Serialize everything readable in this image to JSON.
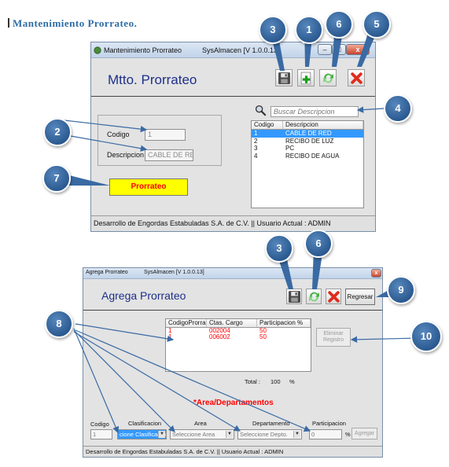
{
  "doc_heading": "Mantenimiento  Prorrateo.",
  "window1": {
    "title": "Mantenimiento Prorrateo",
    "app_version": "SysAlmacen [V 1.0.0.13]",
    "heading": "Mtto. Prorrateo",
    "codigo_label": "Codigo",
    "codigo_value": "1",
    "descripcion_label": "Descripcion",
    "descripcion_value": "CABLE DE RED",
    "prorrateo_button": "Prorrateo",
    "search_placeholder": "Buscar Descripcion",
    "list_headers": [
      "Codigo",
      "Descripcion"
    ],
    "list_rows": [
      {
        "codigo": "1",
        "descripcion": "CABLE DE RED",
        "selected": true
      },
      {
        "codigo": "2",
        "descripcion": "RECIBO DE LUZ",
        "selected": false
      },
      {
        "codigo": "3",
        "descripcion": "PC",
        "selected": false
      },
      {
        "codigo": "4",
        "descripcion": "RECIBO DE AGUA",
        "selected": false
      }
    ],
    "status": "Desarrollo de Engordas Estabuladas S.A. de C.V.  ||  Usuario Actual : ADMIN"
  },
  "window2": {
    "title": "Agrega Prorrateo",
    "app_version": "SysAlmacen [V 1.0.0.13]",
    "heading": "Agrega Prorrateo",
    "regresar_button": "Regresar",
    "grid_headers": [
      "CodigoProrrateo",
      "Ctas. Cargo",
      "Participacion %"
    ],
    "grid_rows": [
      {
        "codigo": "1",
        "cuenta": "002004",
        "participacion": "50"
      },
      {
        "codigo": "1",
        "cuenta": "006002",
        "participacion": "50"
      }
    ],
    "eliminar_button": "Eliminar Registro",
    "total_label": "Total :",
    "total_value": "100",
    "total_unit": "%",
    "area_heading": "*Area/Departamentos",
    "codigo_label": "Codigo",
    "codigo_value": "1",
    "clasificacion_label": "Clasificacion",
    "clasificacion_value": "cione Clasificacion",
    "area_label": "Area",
    "area_value": "Seleccione Area",
    "departamento_label": "Departamento",
    "departamento_value": "Seleccione Depto.",
    "participacion_label": "Participacion",
    "participacion_value": "0",
    "participacion_unit": "%",
    "agregar_button": "Agregar",
    "status": "Desarrollo de Engordas Estabuladas S.A. de C.V.  ||  Usuario Actual : ADMIN"
  },
  "callouts": {
    "w1_save": "3",
    "w1_add": "1",
    "w1_refresh": "6",
    "w1_delete": "5",
    "w1_search": "4",
    "w1_fields": "2",
    "w1_prorrateo": "7",
    "w2_save": "3",
    "w2_refresh": "6",
    "w2_regresar": "9",
    "w2_inputs": "8",
    "w2_eliminar": "10"
  },
  "colors": {
    "callout": "#2b5a91",
    "heading_blue": "#1c2f8a",
    "selected_row": "#3399ff",
    "accent_red": "#ff0000",
    "button_yellow": "#ffff00"
  },
  "icons": [
    "save-icon",
    "add-icon",
    "refresh-icon",
    "delete-icon",
    "search-icon",
    "app-icon"
  ]
}
